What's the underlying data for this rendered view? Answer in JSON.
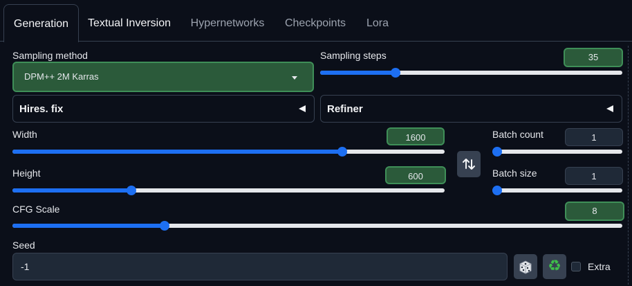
{
  "tabs": [
    {
      "label": "Generation"
    },
    {
      "label": "Textual Inversion"
    },
    {
      "label": "Hypernetworks"
    },
    {
      "label": "Checkpoints"
    },
    {
      "label": "Lora"
    }
  ],
  "sampling_method": {
    "label": "Sampling method",
    "value": "DPM++ 2M Karras"
  },
  "sampling_steps": {
    "label": "Sampling steps",
    "value": "35",
    "fraction": 0.24
  },
  "hires_fix": {
    "label": "Hires. fix"
  },
  "refiner": {
    "label": "Refiner"
  },
  "width": {
    "label": "Width",
    "value": "1600",
    "fraction": 0.77
  },
  "height": {
    "label": "Height",
    "value": "600",
    "fraction": 0.27
  },
  "batch_count": {
    "label": "Batch count",
    "value": "1",
    "fraction": 0.0
  },
  "batch_size": {
    "label": "Batch size",
    "value": "1",
    "fraction": 0.0
  },
  "cfg_scale": {
    "label": "CFG Scale",
    "value": "8",
    "fraction": 0.245
  },
  "seed": {
    "label": "Seed",
    "value": "-1",
    "extra_label": "Extra"
  },
  "colors": {
    "accent": "#1d6ff2",
    "green": "#2b5a3a",
    "background": "#0b0f19"
  }
}
